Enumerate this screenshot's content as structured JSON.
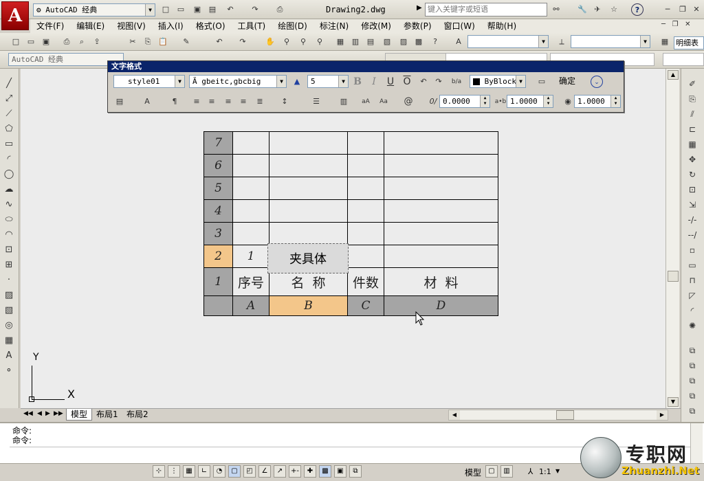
{
  "title_bar": {
    "workspace": "AutoCAD 经典",
    "doc_title": "Drawing2.dwg",
    "search_placeholder": "键入关键字或短语"
  },
  "menu": [
    "文件(F)",
    "编辑(E)",
    "视图(V)",
    "插入(I)",
    "格式(O)",
    "工具(T)",
    "绘图(D)",
    "标注(N)",
    "修改(M)",
    "参数(P)",
    "窗口(W)",
    "帮助(H)"
  ],
  "toolbar3": {
    "workspace_label": "AutoCAD 经典",
    "right_text": "明细表"
  },
  "text_format": {
    "title": "文字格式",
    "style": "style01",
    "font": "gbeitc,gbcbig",
    "height": "5",
    "color": "ByBlock",
    "ok": "确定",
    "oblique": "0.0000",
    "tracking": "1.0000",
    "width_factor": "1.0000"
  },
  "table": {
    "row_numbers": [
      "7",
      "6",
      "5",
      "4",
      "3",
      "2",
      "1"
    ],
    "col_letters": [
      "A",
      "B",
      "C",
      "D"
    ],
    "row2": [
      "1",
      "夹具体",
      "",
      ""
    ],
    "row1": [
      "序号",
      "名  称",
      "件数",
      "材  料"
    ]
  },
  "ucs": {
    "y": "Y",
    "x": "X"
  },
  "tabs": [
    "模型",
    "布局1",
    "布局2"
  ],
  "command": {
    "line1": "命令:",
    "line2": "命令:"
  },
  "status": {
    "model": "模型",
    "scale": "1:1"
  },
  "watermark": {
    "brand": "专职网",
    "url": "Zhuanzhi.Net"
  },
  "colors": {
    "title_bar": "#0a246a",
    "selected_cell": "#f3c68a",
    "header_cell": "#a5a5a5",
    "canvas": "#ececec"
  }
}
